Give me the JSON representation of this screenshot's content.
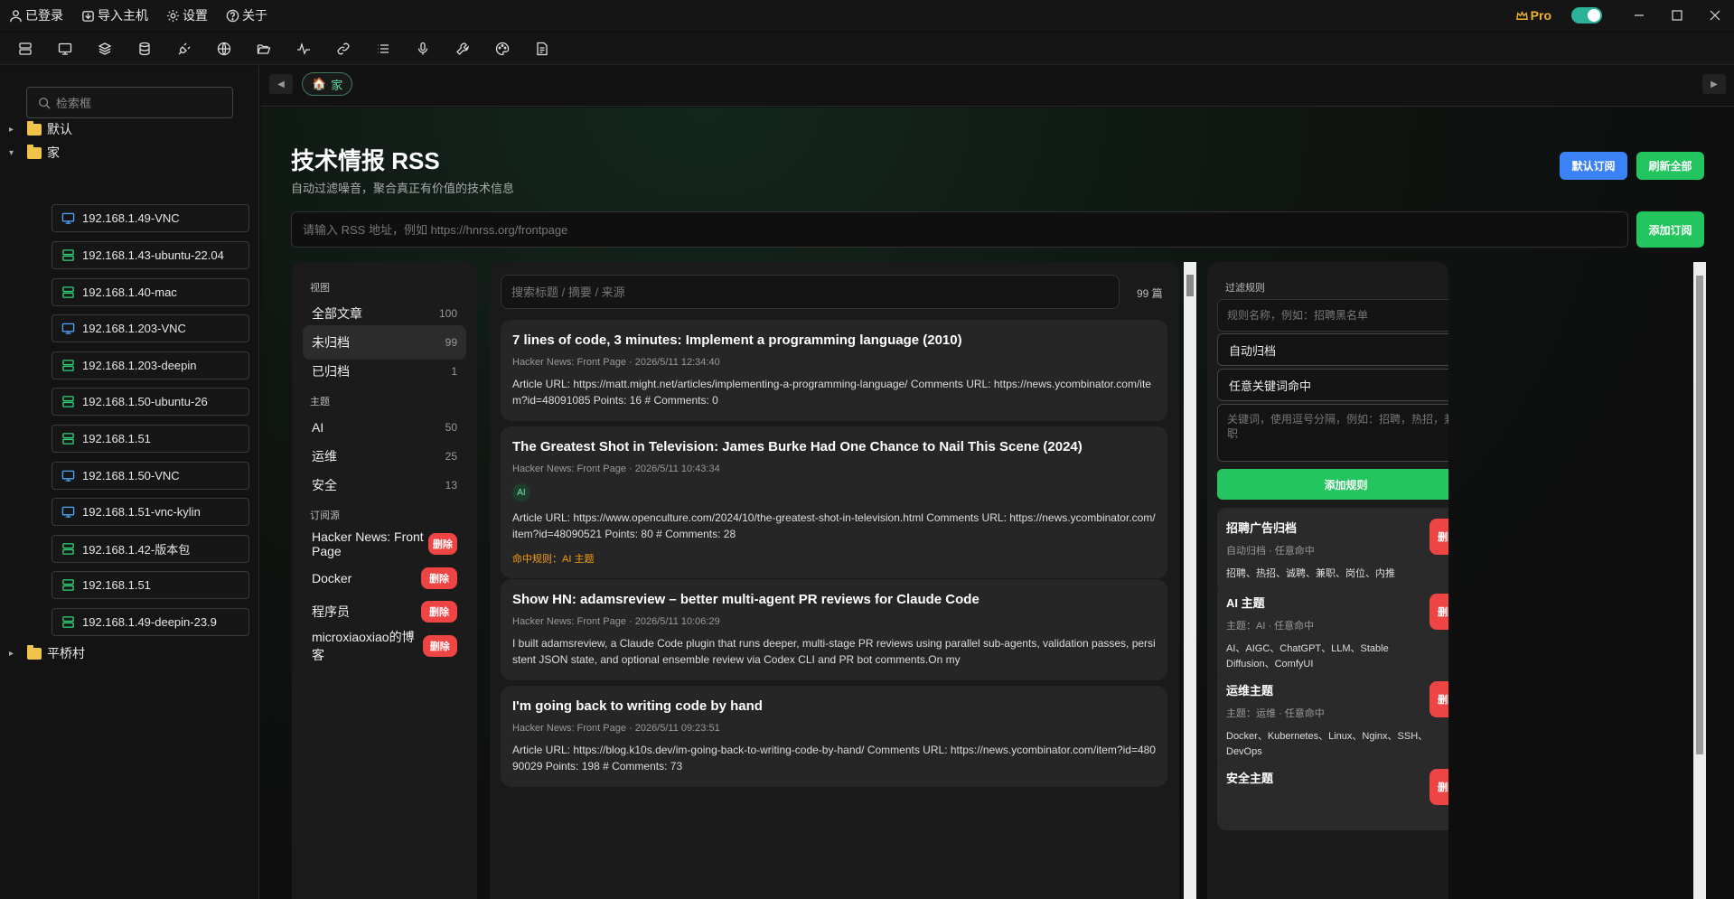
{
  "titlebar": {
    "menu": [
      {
        "label": "已登录",
        "icon": "user-icon"
      },
      {
        "label": "导入主机",
        "icon": "import-icon"
      },
      {
        "label": "设置",
        "icon": "gear-icon"
      },
      {
        "label": "关于",
        "icon": "help-circle-icon"
      }
    ],
    "pro_label": "Pro"
  },
  "toolbar": {
    "icons": [
      "server-list-icon",
      "monitor-icon",
      "layers-icon",
      "database-icon",
      "plug-icon",
      "globe-icon",
      "folder-open-icon",
      "activity-icon",
      "link-icon",
      "list-icon",
      "microphone-icon",
      "wrench-icon",
      "palette-icon",
      "document-icon"
    ]
  },
  "sidebar": {
    "search_placeholder": "检索框",
    "groups": [
      {
        "label": "默认",
        "expanded": false
      },
      {
        "label": "家",
        "expanded": true
      },
      {
        "label": "平桥村",
        "expanded": false
      }
    ],
    "hosts": [
      {
        "label": "192.168.1.49-VNC",
        "type": "vnc"
      },
      {
        "label": "192.168.1.43-ubuntu-22.04",
        "type": "ssh"
      },
      {
        "label": "192.168.1.40-mac",
        "type": "ssh"
      },
      {
        "label": "192.168.1.203-VNC",
        "type": "vnc"
      },
      {
        "label": "192.168.1.203-deepin",
        "type": "ssh"
      },
      {
        "label": "192.168.1.50-ubuntu-26",
        "type": "ssh"
      },
      {
        "label": "192.168.1.51",
        "type": "ssh"
      },
      {
        "label": "192.168.1.50-VNC",
        "type": "vnc"
      },
      {
        "label": "192.168.1.51-vnc-kylin",
        "type": "vnc"
      },
      {
        "label": "192.168.1.42-版本包",
        "type": "ssh"
      },
      {
        "label": "192.168.1.51",
        "type": "ssh"
      },
      {
        "label": "192.168.1.49-deepin-23.9",
        "type": "ssh"
      }
    ]
  },
  "tabs": {
    "home_label": "家"
  },
  "page": {
    "title": "技术情报 RSS",
    "subtitle": "自动过滤噪音，聚合真正有价值的技术信息",
    "btn_default_sub": "默认订阅",
    "btn_refresh_all": "刷新全部",
    "rss_placeholder": "请输入 RSS 地址，例如 https://hnrss.org/frontpage",
    "btn_add_sub": "添加订阅"
  },
  "views": {
    "heading_view": "视图",
    "heading_topic": "主题",
    "heading_source": "订阅源",
    "view_items": [
      {
        "label": "全部文章",
        "count": "100"
      },
      {
        "label": "未归档",
        "count": "99"
      },
      {
        "label": "已归档",
        "count": "1"
      }
    ],
    "topic_items": [
      {
        "label": "AI",
        "count": "50"
      },
      {
        "label": "运维",
        "count": "25"
      },
      {
        "label": "安全",
        "count": "13"
      }
    ],
    "sources": [
      {
        "label": "Hacker News: Front Page"
      },
      {
        "label": "Docker"
      },
      {
        "label": "程序员"
      },
      {
        "label": "microxiaoxiao的博客"
      }
    ],
    "delete_label": "删除"
  },
  "articles": {
    "search_placeholder": "搜索标题 / 摘要 / 来源",
    "count": "99 篇",
    "items": [
      {
        "title": "7 lines of code, 3 minutes: Implement a programming language (2010)",
        "meta": "Hacker News: Front Page · 2026/5/11 12:34:40",
        "body": "Article URL: https://matt.might.net/articles/implementing-a-programming-language/ Comments URL: https://news.ycombinator.com/item?id=48091085 Points: 16 # Comments: 0"
      },
      {
        "title": "The Greatest Shot in Television: James Burke Had One Chance to Nail This Scene (2024)",
        "meta": "Hacker News: Front Page · 2026/5/11 10:43:34",
        "tag": "AI",
        "body": "Article URL: https://www.openculture.com/2024/10/the-greatest-shot-in-television.html Comments URL: https://news.ycombinator.com/item?id=48090521 Points: 80 # Comments: 28",
        "match": "命中规则：AI 主题"
      },
      {
        "title": "Show HN: adamsreview – better multi-agent PR reviews for Claude Code",
        "meta": "Hacker News: Front Page · 2026/5/11 10:06:29",
        "body": "I built adamsreview, a Claude Code plugin that runs deeper, multi-stage PR reviews using parallel sub-agents, validation passes, persistent JSON state, and optional ensemble review via Codex CLI and PR bot comments.On my"
      },
      {
        "title": "I'm going back to writing code by hand",
        "meta": "Hacker News: Front Page · 2026/5/11 09:23:51",
        "body": "Article URL: https://blog.k10s.dev/im-going-back-to-writing-code-by-hand/ Comments URL: https://news.ycombinator.com/item?id=48090029 Points: 198 # Comments: 73"
      }
    ]
  },
  "rules": {
    "heading": "过滤规则",
    "name_placeholder": "规则名称，例如：招聘黑名单",
    "select_action": "自动归档",
    "select_match": "任意关键词命中",
    "keywords_placeholder": "关键词，使用逗号分隔，例如：招聘，热招，兼职",
    "btn_add_rule": "添加规则",
    "delete_label": "删除",
    "items": [
      {
        "name": "招聘广告归档",
        "sub": "自动归档 · 任意命中",
        "keys": "招聘、热招、诚聘、兼职、岗位、内推"
      },
      {
        "name": "AI 主题",
        "sub": "主题：AI · 任意命中",
        "keys": "AI、AIGC、ChatGPT、LLM、Stable Diffusion、ComfyUI"
      },
      {
        "name": "运维主题",
        "sub": "主题：运维 · 任意命中",
        "keys": "Docker、Kubernetes、Linux、Nginx、SSH、DevOps"
      },
      {
        "name": "安全主题",
        "sub": "",
        "keys": ""
      }
    ]
  },
  "colors": {
    "accent_green": "#22c55e",
    "accent_blue": "#3b82f6",
    "danger_red": "#ef4444",
    "warning_orange": "#f59e0b"
  }
}
